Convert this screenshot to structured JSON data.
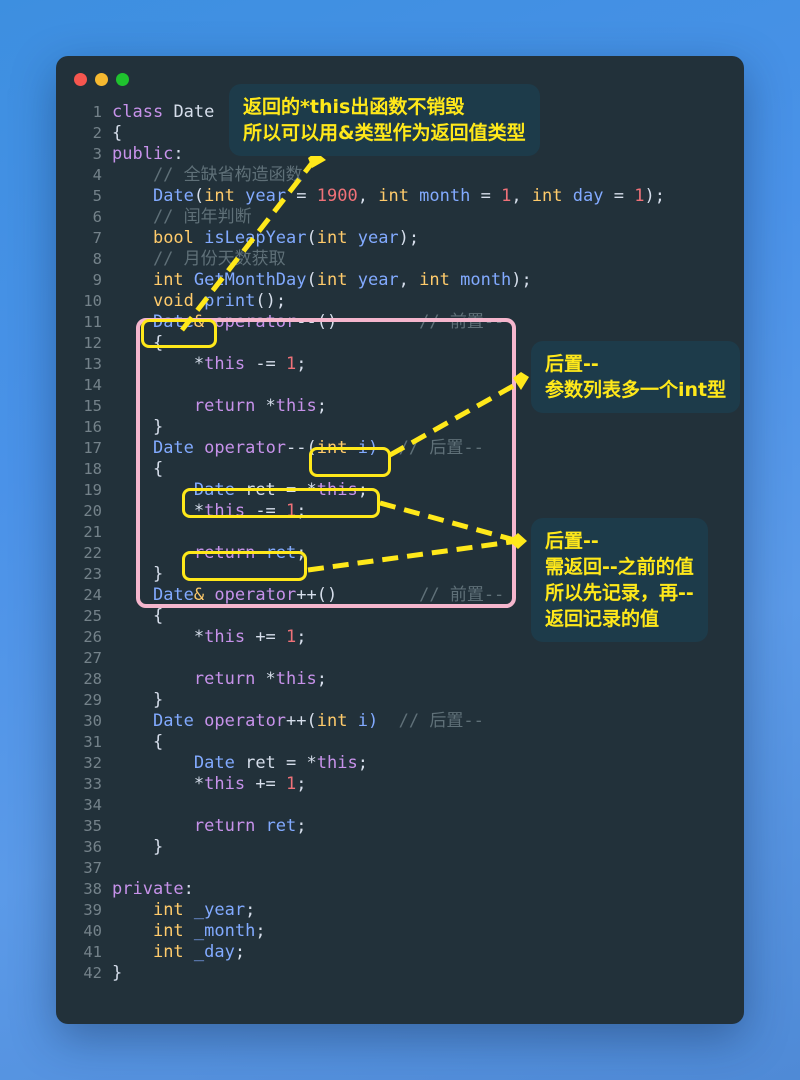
{
  "window": {
    "dots": [
      "close-red",
      "minimize-yellow",
      "maximize-green"
    ]
  },
  "code": {
    "language": "cpp",
    "lines": [
      {
        "n": "1",
        "tokens": [
          {
            "t": "class",
            "c": "kw"
          },
          {
            "t": " ",
            "c": "pun"
          },
          {
            "t": "Date",
            "c": "idn"
          }
        ]
      },
      {
        "n": "2",
        "tokens": [
          {
            "t": "{",
            "c": "pun"
          }
        ]
      },
      {
        "n": "3",
        "tokens": [
          {
            "t": "public",
            "c": "kw"
          },
          {
            "t": ":",
            "c": "pun"
          }
        ]
      },
      {
        "n": "4",
        "tokens": [
          {
            "t": "    // 全缺省构造函数",
            "c": "cmt"
          }
        ]
      },
      {
        "n": "5",
        "tokens": [
          {
            "t": "    ",
            "c": "pun"
          },
          {
            "t": "Date",
            "c": "typ"
          },
          {
            "t": "(",
            "c": "pun"
          },
          {
            "t": "int",
            "c": "ty2"
          },
          {
            "t": " year ",
            "c": "typ"
          },
          {
            "t": "= ",
            "c": "pun"
          },
          {
            "t": "1900",
            "c": "num"
          },
          {
            "t": ", ",
            "c": "pun"
          },
          {
            "t": "int",
            "c": "ty2"
          },
          {
            "t": " month ",
            "c": "typ"
          },
          {
            "t": "= ",
            "c": "pun"
          },
          {
            "t": "1",
            "c": "num"
          },
          {
            "t": ", ",
            "c": "pun"
          },
          {
            "t": "int",
            "c": "ty2"
          },
          {
            "t": " day ",
            "c": "typ"
          },
          {
            "t": "= ",
            "c": "pun"
          },
          {
            "t": "1",
            "c": "num"
          },
          {
            "t": ");",
            "c": "pun"
          }
        ]
      },
      {
        "n": "6",
        "tokens": [
          {
            "t": "    // 闰年判断",
            "c": "cmt"
          }
        ]
      },
      {
        "n": "7",
        "tokens": [
          {
            "t": "    ",
            "c": "pun"
          },
          {
            "t": "bool",
            "c": "ty2"
          },
          {
            "t": " ",
            "c": "pun"
          },
          {
            "t": "isLeapYear",
            "c": "typ"
          },
          {
            "t": "(",
            "c": "pun"
          },
          {
            "t": "int",
            "c": "ty2"
          },
          {
            "t": " year",
            "c": "typ"
          },
          {
            "t": ");",
            "c": "pun"
          }
        ]
      },
      {
        "n": "8",
        "tokens": [
          {
            "t": "    // 月份天数获取",
            "c": "cmt"
          }
        ]
      },
      {
        "n": "9",
        "tokens": [
          {
            "t": "    ",
            "c": "pun"
          },
          {
            "t": "int",
            "c": "ty2"
          },
          {
            "t": " ",
            "c": "pun"
          },
          {
            "t": "GetMonthDay",
            "c": "typ"
          },
          {
            "t": "(",
            "c": "pun"
          },
          {
            "t": "int",
            "c": "ty2"
          },
          {
            "t": " year",
            "c": "typ"
          },
          {
            "t": ", ",
            "c": "pun"
          },
          {
            "t": "int",
            "c": "ty2"
          },
          {
            "t": " month",
            "c": "typ"
          },
          {
            "t": ");",
            "c": "pun"
          }
        ]
      },
      {
        "n": "10",
        "tokens": [
          {
            "t": "    ",
            "c": "pun"
          },
          {
            "t": "void",
            "c": "ty2"
          },
          {
            "t": " ",
            "c": "pun"
          },
          {
            "t": "print",
            "c": "typ"
          },
          {
            "t": "();",
            "c": "pun"
          }
        ]
      },
      {
        "n": "11",
        "tokens": [
          {
            "t": "    ",
            "c": "pun"
          },
          {
            "t": "Date",
            "c": "typ"
          },
          {
            "t": "& ",
            "c": "ty2"
          },
          {
            "t": "operator",
            "c": "kw"
          },
          {
            "t": "--()",
            "c": "pun"
          },
          {
            "t": "        // 前置--",
            "c": "cmt"
          }
        ]
      },
      {
        "n": "12",
        "tokens": [
          {
            "t": "    {",
            "c": "pun"
          }
        ]
      },
      {
        "n": "13",
        "tokens": [
          {
            "t": "        *",
            "c": "pun"
          },
          {
            "t": "this",
            "c": "this"
          },
          {
            "t": " -= ",
            "c": "pun"
          },
          {
            "t": "1",
            "c": "num"
          },
          {
            "t": ";",
            "c": "pun"
          }
        ]
      },
      {
        "n": "14",
        "tokens": [
          {
            "t": "",
            "c": "pun"
          }
        ]
      },
      {
        "n": "15",
        "tokens": [
          {
            "t": "        ",
            "c": "pun"
          },
          {
            "t": "return",
            "c": "kw"
          },
          {
            "t": " *",
            "c": "pun"
          },
          {
            "t": "this",
            "c": "this"
          },
          {
            "t": ";",
            "c": "pun"
          }
        ]
      },
      {
        "n": "16",
        "tokens": [
          {
            "t": "    }",
            "c": "pun"
          }
        ]
      },
      {
        "n": "17",
        "tokens": [
          {
            "t": "    ",
            "c": "pun"
          },
          {
            "t": "Date",
            "c": "typ"
          },
          {
            "t": " ",
            "c": "pun"
          },
          {
            "t": "operator",
            "c": "kw"
          },
          {
            "t": "--(",
            "c": "pun"
          },
          {
            "t": "int",
            "c": "ty2"
          },
          {
            "t": " i)",
            "c": "typ"
          },
          {
            "t": "  // 后置--",
            "c": "cmt"
          }
        ]
      },
      {
        "n": "18",
        "tokens": [
          {
            "t": "    {",
            "c": "pun"
          }
        ]
      },
      {
        "n": "19",
        "tokens": [
          {
            "t": "        ",
            "c": "pun"
          },
          {
            "t": "Date",
            "c": "typ"
          },
          {
            "t": " ret = *",
            "c": "pun"
          },
          {
            "t": "this",
            "c": "this"
          },
          {
            "t": ";",
            "c": "pun"
          }
        ]
      },
      {
        "n": "20",
        "tokens": [
          {
            "t": "        *",
            "c": "pun"
          },
          {
            "t": "this",
            "c": "this"
          },
          {
            "t": " -= ",
            "c": "pun"
          },
          {
            "t": "1",
            "c": "num"
          },
          {
            "t": ";",
            "c": "pun"
          }
        ]
      },
      {
        "n": "21",
        "tokens": [
          {
            "t": "",
            "c": "pun"
          }
        ]
      },
      {
        "n": "22",
        "tokens": [
          {
            "t": "        ",
            "c": "pun"
          },
          {
            "t": "return",
            "c": "kw"
          },
          {
            "t": " ",
            "c": "pun"
          },
          {
            "t": "ret",
            "c": "typ"
          },
          {
            "t": ";",
            "c": "pun"
          }
        ]
      },
      {
        "n": "23",
        "tokens": [
          {
            "t": "    }",
            "c": "pun"
          }
        ]
      },
      {
        "n": "24",
        "tokens": [
          {
            "t": "    ",
            "c": "pun"
          },
          {
            "t": "Date",
            "c": "typ"
          },
          {
            "t": "& ",
            "c": "ty2"
          },
          {
            "t": "operator",
            "c": "kw"
          },
          {
            "t": "++()",
            "c": "pun"
          },
          {
            "t": "        // 前置--",
            "c": "cmt"
          }
        ]
      },
      {
        "n": "25",
        "tokens": [
          {
            "t": "    {",
            "c": "pun"
          }
        ]
      },
      {
        "n": "26",
        "tokens": [
          {
            "t": "        *",
            "c": "pun"
          },
          {
            "t": "this",
            "c": "this"
          },
          {
            "t": " += ",
            "c": "pun"
          },
          {
            "t": "1",
            "c": "num"
          },
          {
            "t": ";",
            "c": "pun"
          }
        ]
      },
      {
        "n": "27",
        "tokens": [
          {
            "t": "",
            "c": "pun"
          }
        ]
      },
      {
        "n": "28",
        "tokens": [
          {
            "t": "        ",
            "c": "pun"
          },
          {
            "t": "return",
            "c": "kw"
          },
          {
            "t": " *",
            "c": "pun"
          },
          {
            "t": "this",
            "c": "this"
          },
          {
            "t": ";",
            "c": "pun"
          }
        ]
      },
      {
        "n": "29",
        "tokens": [
          {
            "t": "    }",
            "c": "pun"
          }
        ]
      },
      {
        "n": "30",
        "tokens": [
          {
            "t": "    ",
            "c": "pun"
          },
          {
            "t": "Date",
            "c": "typ"
          },
          {
            "t": " ",
            "c": "pun"
          },
          {
            "t": "operator",
            "c": "kw"
          },
          {
            "t": "++(",
            "c": "pun"
          },
          {
            "t": "int",
            "c": "ty2"
          },
          {
            "t": " i)",
            "c": "typ"
          },
          {
            "t": "  // 后置--",
            "c": "cmt"
          }
        ]
      },
      {
        "n": "31",
        "tokens": [
          {
            "t": "    {",
            "c": "pun"
          }
        ]
      },
      {
        "n": "32",
        "tokens": [
          {
            "t": "        ",
            "c": "pun"
          },
          {
            "t": "Date",
            "c": "typ"
          },
          {
            "t": " ret = *",
            "c": "pun"
          },
          {
            "t": "this",
            "c": "this"
          },
          {
            "t": ";",
            "c": "pun"
          }
        ]
      },
      {
        "n": "33",
        "tokens": [
          {
            "t": "        *",
            "c": "pun"
          },
          {
            "t": "this",
            "c": "this"
          },
          {
            "t": " += ",
            "c": "pun"
          },
          {
            "t": "1",
            "c": "num"
          },
          {
            "t": ";",
            "c": "pun"
          }
        ]
      },
      {
        "n": "34",
        "tokens": [
          {
            "t": "",
            "c": "pun"
          }
        ]
      },
      {
        "n": "35",
        "tokens": [
          {
            "t": "        ",
            "c": "pun"
          },
          {
            "t": "return",
            "c": "kw"
          },
          {
            "t": " ",
            "c": "pun"
          },
          {
            "t": "ret",
            "c": "typ"
          },
          {
            "t": ";",
            "c": "pun"
          }
        ]
      },
      {
        "n": "36",
        "tokens": [
          {
            "t": "    }",
            "c": "pun"
          }
        ]
      },
      {
        "n": "37",
        "tokens": [
          {
            "t": "",
            "c": "pun"
          }
        ]
      },
      {
        "n": "38",
        "tokens": [
          {
            "t": "private",
            "c": "kw"
          },
          {
            "t": ":",
            "c": "pun"
          }
        ]
      },
      {
        "n": "39",
        "tokens": [
          {
            "t": "    ",
            "c": "pun"
          },
          {
            "t": "int",
            "c": "ty2"
          },
          {
            "t": " _year",
            "c": "typ"
          },
          {
            "t": ";",
            "c": "pun"
          }
        ]
      },
      {
        "n": "40",
        "tokens": [
          {
            "t": "    ",
            "c": "pun"
          },
          {
            "t": "int",
            "c": "ty2"
          },
          {
            "t": " _month",
            "c": "typ"
          },
          {
            "t": ";",
            "c": "pun"
          }
        ]
      },
      {
        "n": "41",
        "tokens": [
          {
            "t": "    ",
            "c": "pun"
          },
          {
            "t": "int",
            "c": "ty2"
          },
          {
            "t": " _day",
            "c": "typ"
          },
          {
            "t": ";",
            "c": "pun"
          }
        ]
      },
      {
        "n": "42",
        "tokens": [
          {
            "t": "}",
            "c": "pun"
          }
        ]
      }
    ]
  },
  "annotations": {
    "callouts": [
      {
        "id": "callout-0",
        "text": "返回的*this出函数不销毁\n所以可以用&类型作为返回值类型"
      },
      {
        "id": "callout-1",
        "text": "后置--\n参数列表多一个int型"
      },
      {
        "id": "callout-2",
        "text": "后置--\n需返回--之前的值\n所以先记录，再--\n返回记录的值"
      }
    ],
    "highlights": [
      {
        "id": "hl-date-ref",
        "label": "Date&"
      },
      {
        "id": "hl-int-i",
        "label": "(int i)"
      },
      {
        "id": "hl-date-ret",
        "label": "Date ret = *this;"
      },
      {
        "id": "hl-return-ret",
        "label": "return ret;"
      }
    ],
    "region_label": "pink-region-postfix-prefix-decrement"
  },
  "colors": {
    "background_blue": "#4a92e8",
    "editor_bg": "#22313a",
    "callout_bg": "#1d3b4a",
    "annotation_yellow": "#ffe81a",
    "region_pink": "#f5b6cd"
  }
}
